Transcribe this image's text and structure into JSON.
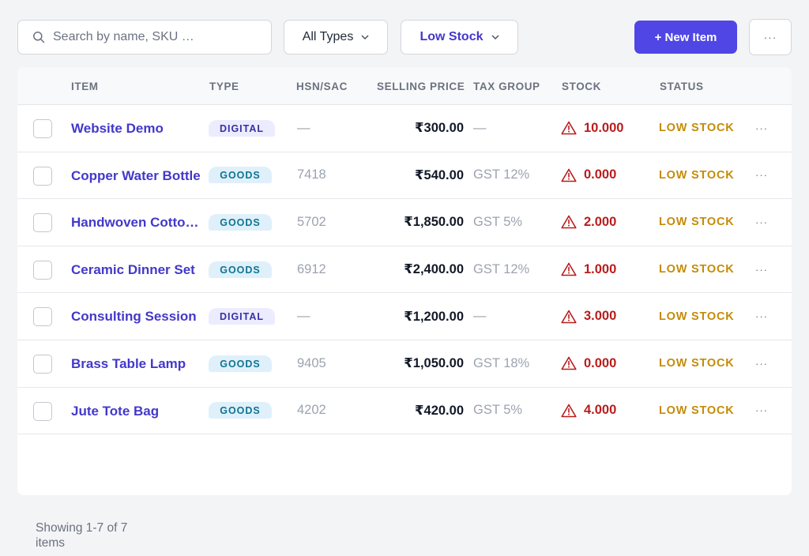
{
  "toolbar": {
    "search_placeholder": "Search by name, SKU …",
    "type_filter": "All Types",
    "stock_filter": "Low Stock",
    "new_item_label": "+ New Item",
    "more_label": "···"
  },
  "table": {
    "columns": [
      "ITEM",
      "TYPE",
      "HSN/SAC",
      "SELLING PRICE",
      "TAX GROUP",
      "STOCK",
      "STATUS"
    ],
    "rows": [
      {
        "name": "Website Demo",
        "type": "DIGITAL",
        "hsn": "—",
        "price": "₹300.00",
        "tax": "—",
        "stock": "10.000",
        "status": "LOW STOCK"
      },
      {
        "name": "Copper Water Bottle",
        "type": "GOODS",
        "hsn": "7418",
        "price": "₹540.00",
        "tax": "GST 12%",
        "stock": "0.000",
        "status": "LOW STOCK"
      },
      {
        "name": "Handwoven Cotton Throw",
        "type": "GOODS",
        "hsn": "5702",
        "price": "₹1,850.00",
        "tax": "GST 5%",
        "stock": "2.000",
        "status": "LOW STOCK"
      },
      {
        "name": "Ceramic Dinner Set",
        "type": "GOODS",
        "hsn": "6912",
        "price": "₹2,400.00",
        "tax": "GST 12%",
        "stock": "1.000",
        "status": "LOW STOCK"
      },
      {
        "name": "Consulting Session",
        "type": "DIGITAL",
        "hsn": "—",
        "price": "₹1,200.00",
        "tax": "—",
        "stock": "3.000",
        "status": "LOW STOCK"
      },
      {
        "name": "Brass Table Lamp",
        "type": "GOODS",
        "hsn": "9405",
        "price": "₹1,050.00",
        "tax": "GST 18%",
        "stock": "0.000",
        "status": "LOW STOCK"
      },
      {
        "name": "Jute Tote Bag",
        "type": "GOODS",
        "hsn": "4202",
        "price": "₹420.00",
        "tax": "GST 5%",
        "stock": "4.000",
        "status": "LOW STOCK"
      }
    ],
    "row_more_label": "···"
  },
  "footer": {
    "summary": "Showing 1-7 of 7 items"
  },
  "colors": {
    "accent": "#4f46e5",
    "danger": "#b91c1c",
    "warning": "#c58b07"
  },
  "icons": {
    "search": "search-icon",
    "chevron": "chevron-down-icon",
    "stock_alert": "warning-triangle-icon"
  }
}
